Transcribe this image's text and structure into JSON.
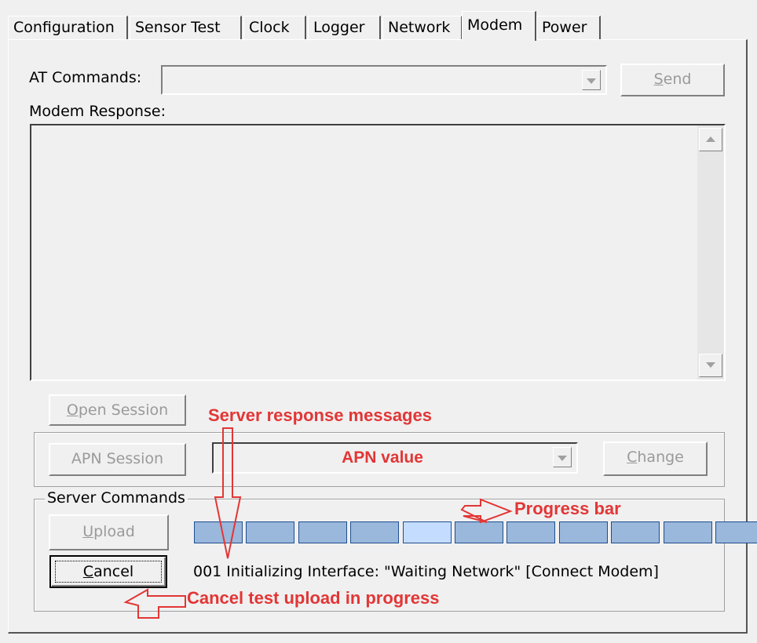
{
  "tabs": [
    {
      "label": "Configuration",
      "active": false
    },
    {
      "label": "Sensor Test",
      "active": false
    },
    {
      "label": "Clock",
      "active": false
    },
    {
      "label": "Logger",
      "active": false
    },
    {
      "label": "Network",
      "active": false
    },
    {
      "label": "Modem",
      "active": true
    },
    {
      "label": "Power",
      "active": false
    }
  ],
  "at_commands": {
    "label": "AT Commands:",
    "value": ""
  },
  "send_button": {
    "label_first": "S",
    "label_rest": "end",
    "enabled": false
  },
  "modem_response": {
    "label": "Modem Response:",
    "text": ""
  },
  "open_session_button": {
    "label_first": "O",
    "label_rest": "pen Session",
    "enabled": false
  },
  "apn_session_button": {
    "label": "APN Session",
    "enabled": false
  },
  "apn_combo": {
    "value": "APN value"
  },
  "change_button": {
    "label_first": "C",
    "label_rest": "hange",
    "enabled": false
  },
  "server_commands": {
    "legend": "Server Commands",
    "upload_button": {
      "label_first": "U",
      "label_rest": "pload",
      "enabled": false
    },
    "cancel_button": {
      "label_first": "C",
      "label_rest": "ancel",
      "enabled": true
    },
    "progress_segments": 11,
    "progress_highlight_index": 4,
    "status_message": "001 Initializing Interface: \"Waiting Network\" [Connect Modem]"
  },
  "annotations": {
    "server_response": "Server response messages",
    "progress_bar": "Progress bar",
    "cancel_upload": "Cancel test upload in progress"
  },
  "colors": {
    "annotation": "#e23636",
    "progress_fill": "#9ab7dc",
    "progress_highlight": "#c4dcff",
    "progress_border": "#1f4f8f"
  }
}
